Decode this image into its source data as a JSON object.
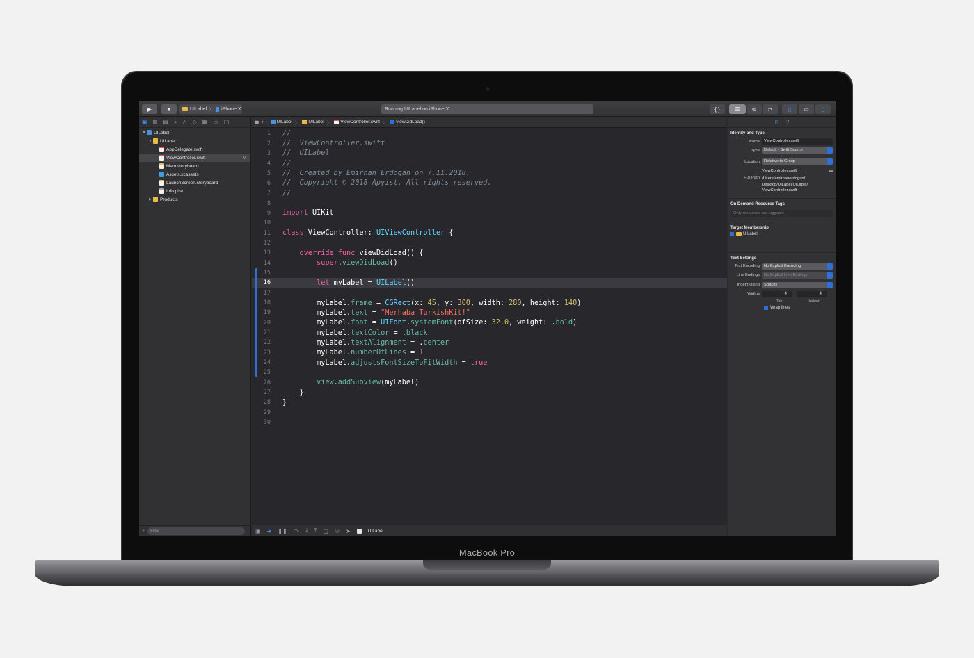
{
  "device": {
    "brand_label": "MacBook Pro"
  },
  "toolbar": {
    "run_icon": "play-icon",
    "stop_icon": "stop-icon",
    "scheme": "UILabel",
    "destination": "iPhone X",
    "activity_status": "Running UILabel on iPhone X"
  },
  "navigator": {
    "tree": [
      {
        "label": "UILabel",
        "indent": 0,
        "expanded": true,
        "icon": "project-icon"
      },
      {
        "label": "UILabel",
        "indent": 1,
        "expanded": true,
        "icon": "folder-icon"
      },
      {
        "label": "AppDelegate.swift",
        "indent": 2,
        "icon": "swift-file-icon"
      },
      {
        "label": "ViewController.swift",
        "indent": 2,
        "icon": "swift-file-icon",
        "selected": true,
        "badge": "M"
      },
      {
        "label": "Main.storyboard",
        "indent": 2,
        "icon": "storyboard-icon"
      },
      {
        "label": "Assets.xcassets",
        "indent": 2,
        "icon": "assets-icon"
      },
      {
        "label": "LaunchScreen.storyboard",
        "indent": 2,
        "icon": "storyboard-icon"
      },
      {
        "label": "Info.plist",
        "indent": 2,
        "icon": "plist-icon"
      },
      {
        "label": "Products",
        "indent": 1,
        "expanded": false,
        "icon": "folder-icon"
      }
    ],
    "filter_placeholder": "Filter"
  },
  "jumpbar": {
    "crumbs": [
      "UILabel",
      "UILabel",
      "ViewController.swift",
      "viewDidLoad()"
    ]
  },
  "editor": {
    "current_line": 16,
    "lines": [
      {
        "n": "1",
        "html": "<span class='cmt'>//</span>"
      },
      {
        "n": "2",
        "html": "<span class='cmt'>//  ViewController.swift</span>"
      },
      {
        "n": "3",
        "html": "<span class='cmt'>//  UILabel</span>"
      },
      {
        "n": "4",
        "html": "<span class='cmt'>//</span>"
      },
      {
        "n": "5",
        "html": "<span class='cmt'>//  Created by Emirhan Erdogan on 7.11.2018.</span>"
      },
      {
        "n": "6",
        "html": "<span class='cmt'>//  Copyright © 2018 Apyist. All rights reserved.</span>"
      },
      {
        "n": "7",
        "html": "<span class='cmt'>//</span>"
      },
      {
        "n": "8",
        "html": ""
      },
      {
        "n": "9",
        "html": "<span class='kw'>import</span> UIKit"
      },
      {
        "n": "10",
        "html": ""
      },
      {
        "n": "11",
        "html": "<span class='kw'>class</span> ViewController: <span class='typ'>UIViewController</span> {"
      },
      {
        "n": "12",
        "html": ""
      },
      {
        "n": "13",
        "html": "    <span class='kw'>override</span> <span class='kw'>func</span> viewDidLoad() {"
      },
      {
        "n": "14",
        "html": "        <span class='kw'>super</span>.<span class='fnc'>viewDidLoad</span>()"
      },
      {
        "n": "15",
        "html": ""
      },
      {
        "n": "16",
        "html": "        <span class='kw'>let</span> myLabel = <span class='typ'>UILabel</span>()"
      },
      {
        "n": "17",
        "html": ""
      },
      {
        "n": "18",
        "html": "        myLabel.<span class='prop'>frame</span> = <span class='typ'>CGRect</span>(x: <span class='num'>45</span>, y: <span class='num'>300</span>, width: <span class='num'>280</span>, height: <span class='num'>140</span>)"
      },
      {
        "n": "19",
        "html": "        myLabel.<span class='prop'>text</span> = <span class='str'>\"Merhaba TurkishKit!\"</span>"
      },
      {
        "n": "20",
        "html": "        myLabel.<span class='prop'>font</span> = <span class='typ'>UIFont</span>.<span class='fnc'>systemFont</span>(ofSize: <span class='num'>32.0</span>, weight: .<span class='prop'>bold</span>)"
      },
      {
        "n": "21",
        "html": "        myLabel.<span class='prop'>textColor</span> = .<span class='prop'>black</span>"
      },
      {
        "n": "22",
        "html": "        myLabel.<span class='prop'>textAlignment</span> = .<span class='prop'>center</span>"
      },
      {
        "n": "23",
        "html": "        myLabel.<span class='prop'>numberOfLines</span> = <span class='other'>1</span>"
      },
      {
        "n": "24",
        "html": "        myLabel.<span class='prop'>adjustsFontSizeToFitWidth</span> = <span class='kw'>true</span>"
      },
      {
        "n": "25",
        "html": ""
      },
      {
        "n": "26",
        "html": "        <span class='prop'>view</span>.<span class='fnc'>addSubview</span>(myLabel)"
      },
      {
        "n": "27",
        "html": "    }"
      },
      {
        "n": "28",
        "html": "}"
      },
      {
        "n": "29",
        "html": ""
      },
      {
        "n": "30",
        "html": ""
      }
    ]
  },
  "debug_bar": {
    "target_label": "UILabel"
  },
  "inspector": {
    "identity_title": "Identity and Type",
    "name_label": "Name",
    "name_value": "ViewController.swift",
    "type_label": "Type",
    "type_value": "Default - Swift Source",
    "location_label": "Location",
    "location_value": "Relative to Group",
    "location_file": "ViewController.swift",
    "fullpath_label": "Full Path",
    "fullpath_value": "/Users/emirhanerdogan/ Desktop/UILabel/UILabel/ ViewController.swift",
    "odr_title": "On Demand Resource Tags",
    "odr_placeholder": "Only resources are taggable",
    "membership_title": "Target Membership",
    "membership_target": "UILabel",
    "text_title": "Text Settings",
    "encoding_label": "Text Encoding",
    "encoding_value": "No Explicit Encoding",
    "endings_label": "Line Endings",
    "endings_value": "No Explicit Line Endings",
    "indent_label": "Indent Using",
    "indent_value": "Spaces",
    "widths_label": "Widths",
    "tab_value": "4",
    "indent_width_value": "4",
    "tab_caption": "Tab",
    "indent_caption": "Indent",
    "wrap_label": "Wrap lines"
  }
}
